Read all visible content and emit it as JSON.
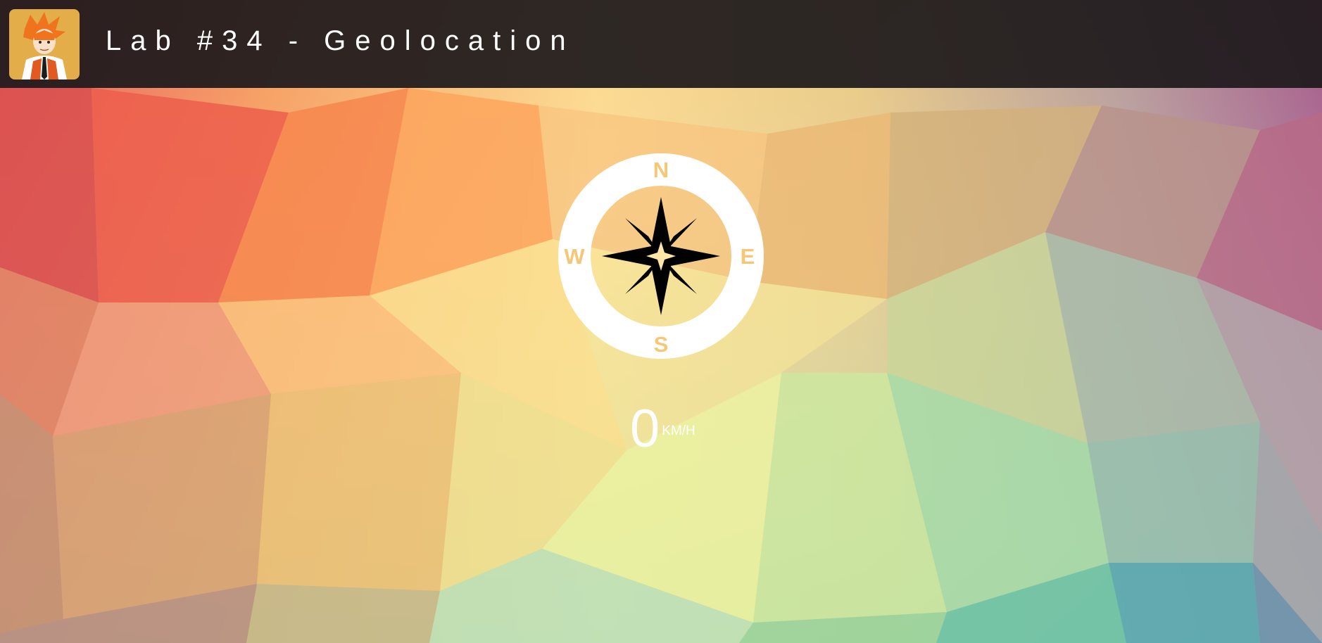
{
  "header": {
    "title": "Lab #34 - Geolocation",
    "background_color": "#2a2325"
  },
  "compass": {
    "north": "N",
    "east": "E",
    "south": "S",
    "west": "W",
    "ring_color": "#ffffff",
    "label_color": "#f6c776",
    "needle_color": "#000000",
    "icon": "compass-rose-icon"
  },
  "speed": {
    "value": "0",
    "unit": "KM/H"
  }
}
